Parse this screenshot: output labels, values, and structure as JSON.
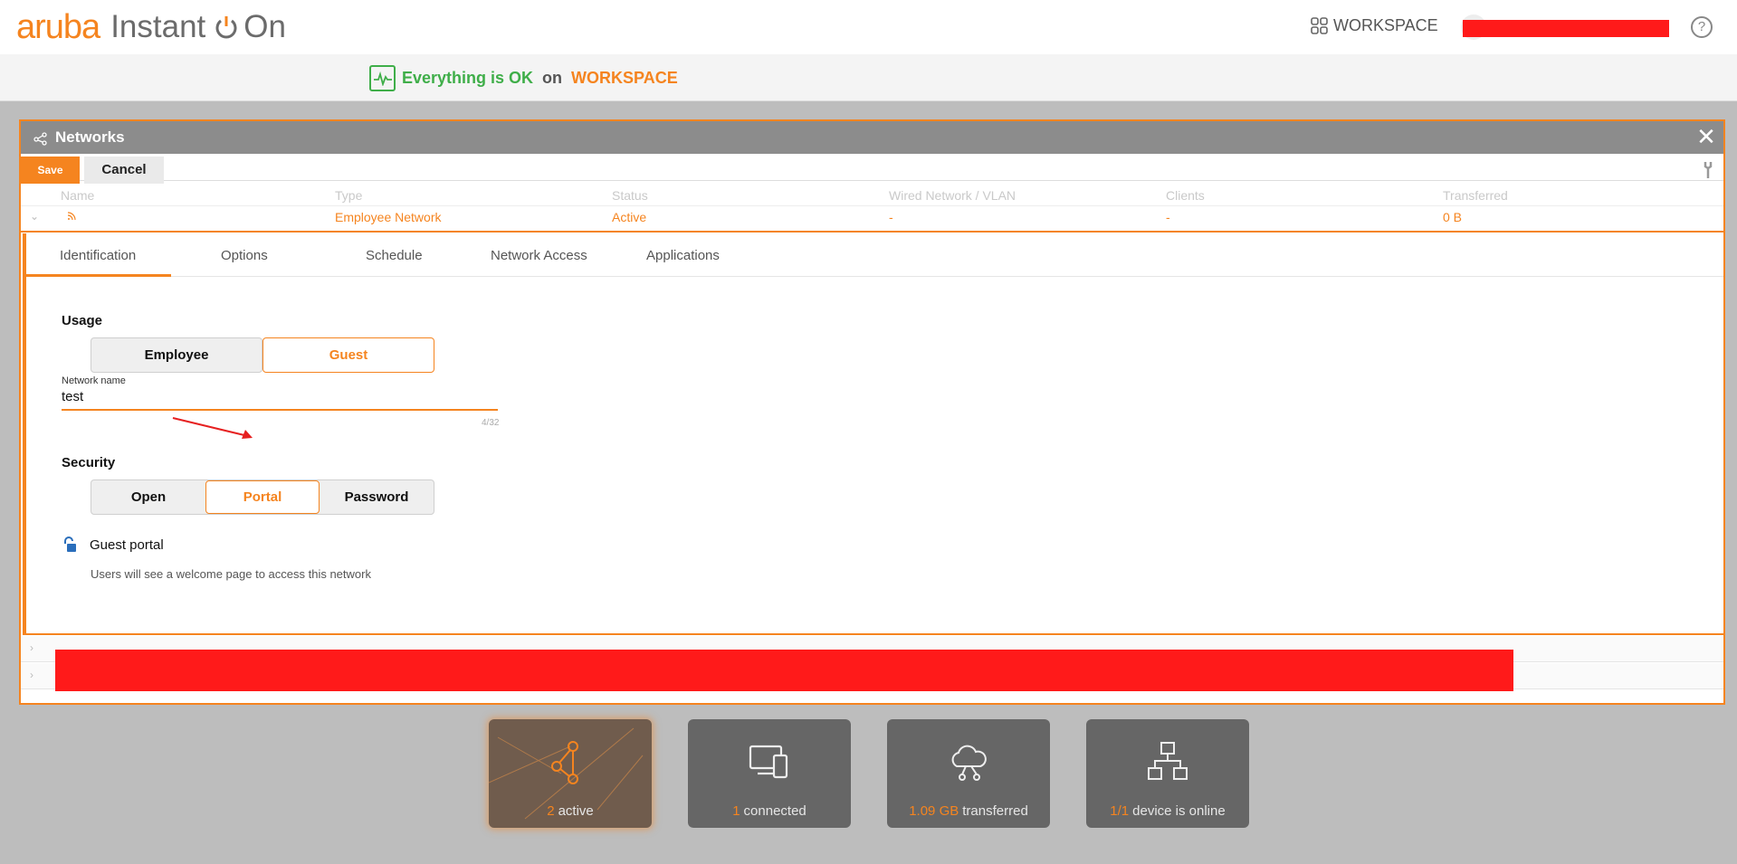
{
  "app": {
    "logo_aruba": "aruba",
    "logo_instant": "Instant",
    "logo_on": "On",
    "workspace_label": "WORKSPACE",
    "help_symbol": "?"
  },
  "status": {
    "ok_text": "Everything is OK",
    "on_text": "on",
    "workspace": "WORKSPACE"
  },
  "modal": {
    "title": "Networks",
    "save_label": "Save",
    "cancel_label": "Cancel",
    "columns": [
      "Name",
      "Type",
      "Status",
      "Wired Network / VLAN",
      "Clients",
      "Transferred"
    ],
    "row": {
      "name": "",
      "type": "Employee Network",
      "status": "Active",
      "vlan": "-",
      "clients": "-",
      "transferred": "0 B"
    },
    "tabs": [
      "Identification",
      "Options",
      "Schedule",
      "Network Access",
      "Applications"
    ],
    "usage_label": "Usage",
    "usage_options": [
      "Employee",
      "Guest"
    ],
    "usage_selected": "Guest",
    "network_name_label": "Network name",
    "network_name_value": "test",
    "network_name_counter": "4/32",
    "security_label": "Security",
    "security_options": [
      "Open",
      "Portal",
      "Password"
    ],
    "security_selected": "Portal",
    "guest_portal_label": "Guest portal",
    "guest_portal_desc": "Users will see a welcome page to access this network"
  },
  "tiles": [
    {
      "num": "2",
      "text": "active"
    },
    {
      "num": "1",
      "text": "connected"
    },
    {
      "num": "1.09 GB",
      "text": "transferred"
    },
    {
      "num": "1/1",
      "text": "device is online"
    }
  ],
  "colors": {
    "accent": "#f5841f",
    "ok_green": "#3fae49",
    "redaction": "#ff1a1a"
  }
}
